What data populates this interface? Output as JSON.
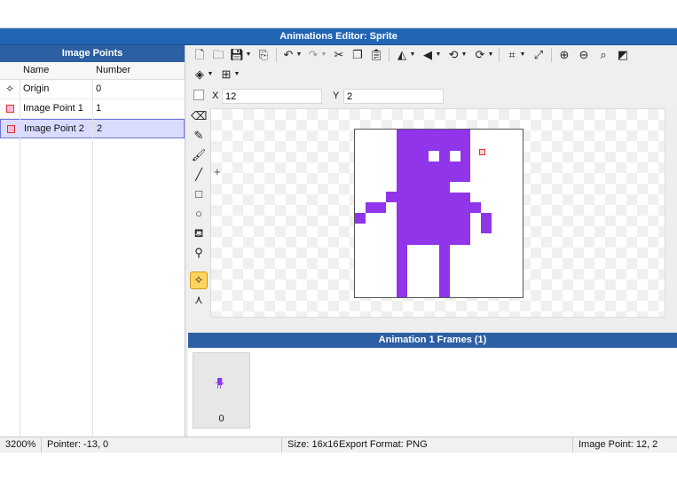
{
  "window": {
    "title": "Animations Editor: Sprite"
  },
  "left_panel": {
    "header": "Image Points",
    "columns": {
      "name": "Name",
      "number": "Number"
    },
    "rows": [
      {
        "icon": "origin-icon",
        "name": "Origin",
        "number": "0",
        "selected": false
      },
      {
        "icon": "image-point-icon",
        "name": "Image Point 1",
        "number": "1",
        "selected": false
      },
      {
        "icon": "image-point-icon",
        "name": "Image Point 2",
        "number": "2",
        "selected": true
      }
    ]
  },
  "toolbar": {
    "icons": [
      "new-file-icon",
      "open-folder-icon",
      "save-icon",
      "export-icon",
      "undo-icon",
      "redo-icon",
      "cut-icon",
      "copy-icon",
      "paste-icon",
      "flip-horizontal-icon",
      "flip-vertical-icon",
      "rotate-left-icon",
      "rotate-right-icon",
      "crop-icon",
      "resize-icon",
      "zoom-in-icon",
      "zoom-out-icon",
      "zoom-reset-icon",
      "toggle-background-icon",
      "layers-icon",
      "grid-icon"
    ]
  },
  "coords": {
    "x_label": "X",
    "x_value": "12",
    "y_label": "Y",
    "y_value": "2"
  },
  "tools": [
    "eraser-icon",
    "pencil-icon",
    "brush-icon",
    "line-icon",
    "rectangle-icon",
    "ellipse-icon",
    "fill-bucket-icon",
    "eyedropper-icon",
    "image-point-tool-icon",
    "bone-tool-icon"
  ],
  "active_tool": "image-point-tool-icon",
  "canvas": {
    "sprite_color": "#9035ea",
    "sprite_size": "16x16"
  },
  "frames": {
    "header": "Animation 1 Frames (1)",
    "items": [
      {
        "number": "0"
      }
    ]
  },
  "status": {
    "zoom": "3200%",
    "pointer": "Pointer: -13, 0",
    "size": "Size: 16x16",
    "export": "Export Format: PNG",
    "image_point": "Image Point: 12, 2"
  }
}
